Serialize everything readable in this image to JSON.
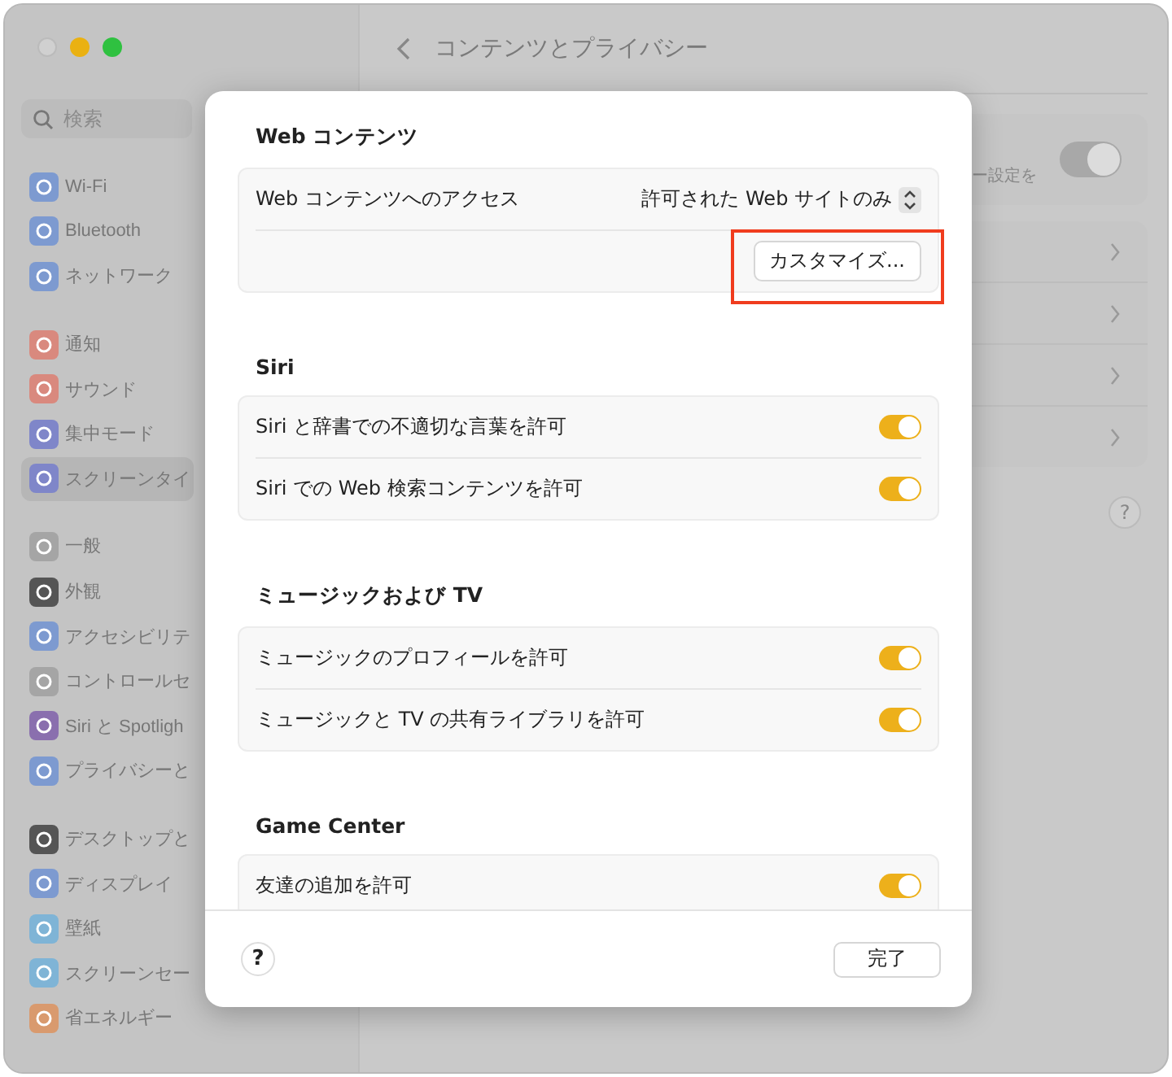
{
  "window": {
    "title": "コンテンツとプライバシー"
  },
  "search": {
    "placeholder": "検索"
  },
  "sidebar": {
    "groups": [
      [
        {
          "label": "Wi-Fi",
          "color": "#7d9ad0",
          "selected": false
        },
        {
          "label": "Bluetooth",
          "color": "#7d9ad0",
          "selected": false
        },
        {
          "label": "ネットワーク",
          "color": "#7d9ad0",
          "selected": false
        }
      ],
      [
        {
          "label": "通知",
          "color": "#d9897e",
          "selected": false
        },
        {
          "label": "サウンド",
          "color": "#d9897e",
          "selected": false
        },
        {
          "label": "集中モード",
          "color": "#7f86c9",
          "selected": false
        },
        {
          "label": "スクリーンタイ",
          "color": "#7f86c9",
          "selected": true
        }
      ],
      [
        {
          "label": "一般",
          "color": "#a5a5a5",
          "selected": false
        },
        {
          "label": "外観",
          "color": "#555555",
          "selected": false
        },
        {
          "label": "アクセシビリテ",
          "color": "#7d9ad0",
          "selected": false
        },
        {
          "label": "コントロールセ",
          "color": "#a5a5a5",
          "selected": false
        },
        {
          "label": "Siri と Spotligh",
          "color": "#8a6fae",
          "selected": false
        },
        {
          "label": "プライバシーと",
          "color": "#7d9ad0",
          "selected": false
        }
      ],
      [
        {
          "label": "デスクトップと",
          "color": "#555555",
          "selected": false
        },
        {
          "label": "ディスプレイ",
          "color": "#7d9ad0",
          "selected": false
        },
        {
          "label": "壁紙",
          "color": "#7fb4d6",
          "selected": false
        },
        {
          "label": "スクリーンセー",
          "color": "#7fb4d6",
          "selected": false
        },
        {
          "label": "省エネルギー",
          "color": "#d99a6e",
          "selected": false
        }
      ]
    ]
  },
  "main": {
    "setting_text": "ー設定を",
    "setting_on": true,
    "rows": [
      {
        "kind": "link"
      },
      {
        "kind": "link"
      },
      {
        "kind": "link"
      },
      {
        "kind": "link"
      }
    ]
  },
  "dialog": {
    "sections": [
      {
        "title": "Web コンテンツ",
        "rows": [
          {
            "kind": "popup",
            "label": "Web コンテンツへのアクセス",
            "value": "許可された Web サイトのみ"
          },
          {
            "kind": "button",
            "label": "カスタマイズ...",
            "highlighted": true
          }
        ]
      },
      {
        "title": "Siri",
        "rows": [
          {
            "kind": "toggle",
            "label": "Siri と辞書での不適切な言葉を許可",
            "on": true
          },
          {
            "kind": "toggle",
            "label": "Siri での Web 検索コンテンツを許可",
            "on": true
          }
        ]
      },
      {
        "title": "ミュージックおよび TV",
        "rows": [
          {
            "kind": "toggle",
            "label": "ミュージックのプロフィールを許可",
            "on": true
          },
          {
            "kind": "toggle",
            "label": "ミュージックと TV の共有ライブラリを許可",
            "on": true
          }
        ]
      },
      {
        "title": "Game Center",
        "rows": [
          {
            "kind": "toggle",
            "label": "友達の追加を許可",
            "on": true
          }
        ]
      }
    ],
    "help": "?",
    "done": "完了"
  }
}
